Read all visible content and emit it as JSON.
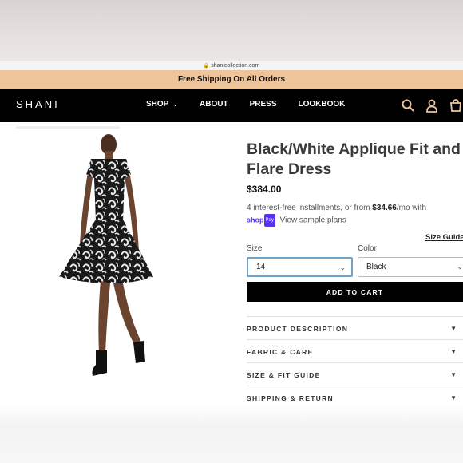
{
  "url_bar": {
    "url": "shanicollection.com"
  },
  "announcement": {
    "text": "Free Shipping On All Orders"
  },
  "nav": {
    "logo": "SHANI",
    "menu": [
      {
        "label": "SHOP",
        "has_dropdown": true
      },
      {
        "label": "ABOUT"
      },
      {
        "label": "PRESS"
      },
      {
        "label": "LOOKBOOK"
      }
    ],
    "icons": [
      "search-icon",
      "account-icon",
      "cart-icon"
    ],
    "accent": "#eec49b"
  },
  "product": {
    "title": "Black/White Applique Fit and Flare Dress",
    "price": "$384.00",
    "installments_text_1": "4 interest-free installments, or from ",
    "installments_amount": "$34.66",
    "installments_text_2": "/mo with",
    "shop_pay": "shop",
    "shop_pay_badge": "Pay",
    "sample_link": "View sample plans",
    "size_guide": "Size Guide",
    "size_label": "Size",
    "size_value": "14",
    "color_label": "Color",
    "color_value": "Black",
    "add_to_cart": "ADD TO CART"
  },
  "accordions": [
    {
      "label": "PRODUCT DESCRIPTION"
    },
    {
      "label": "FABRIC & CARE"
    },
    {
      "label": "SIZE & FIT GUIDE"
    },
    {
      "label": "SHIPPING & RETURN"
    }
  ]
}
